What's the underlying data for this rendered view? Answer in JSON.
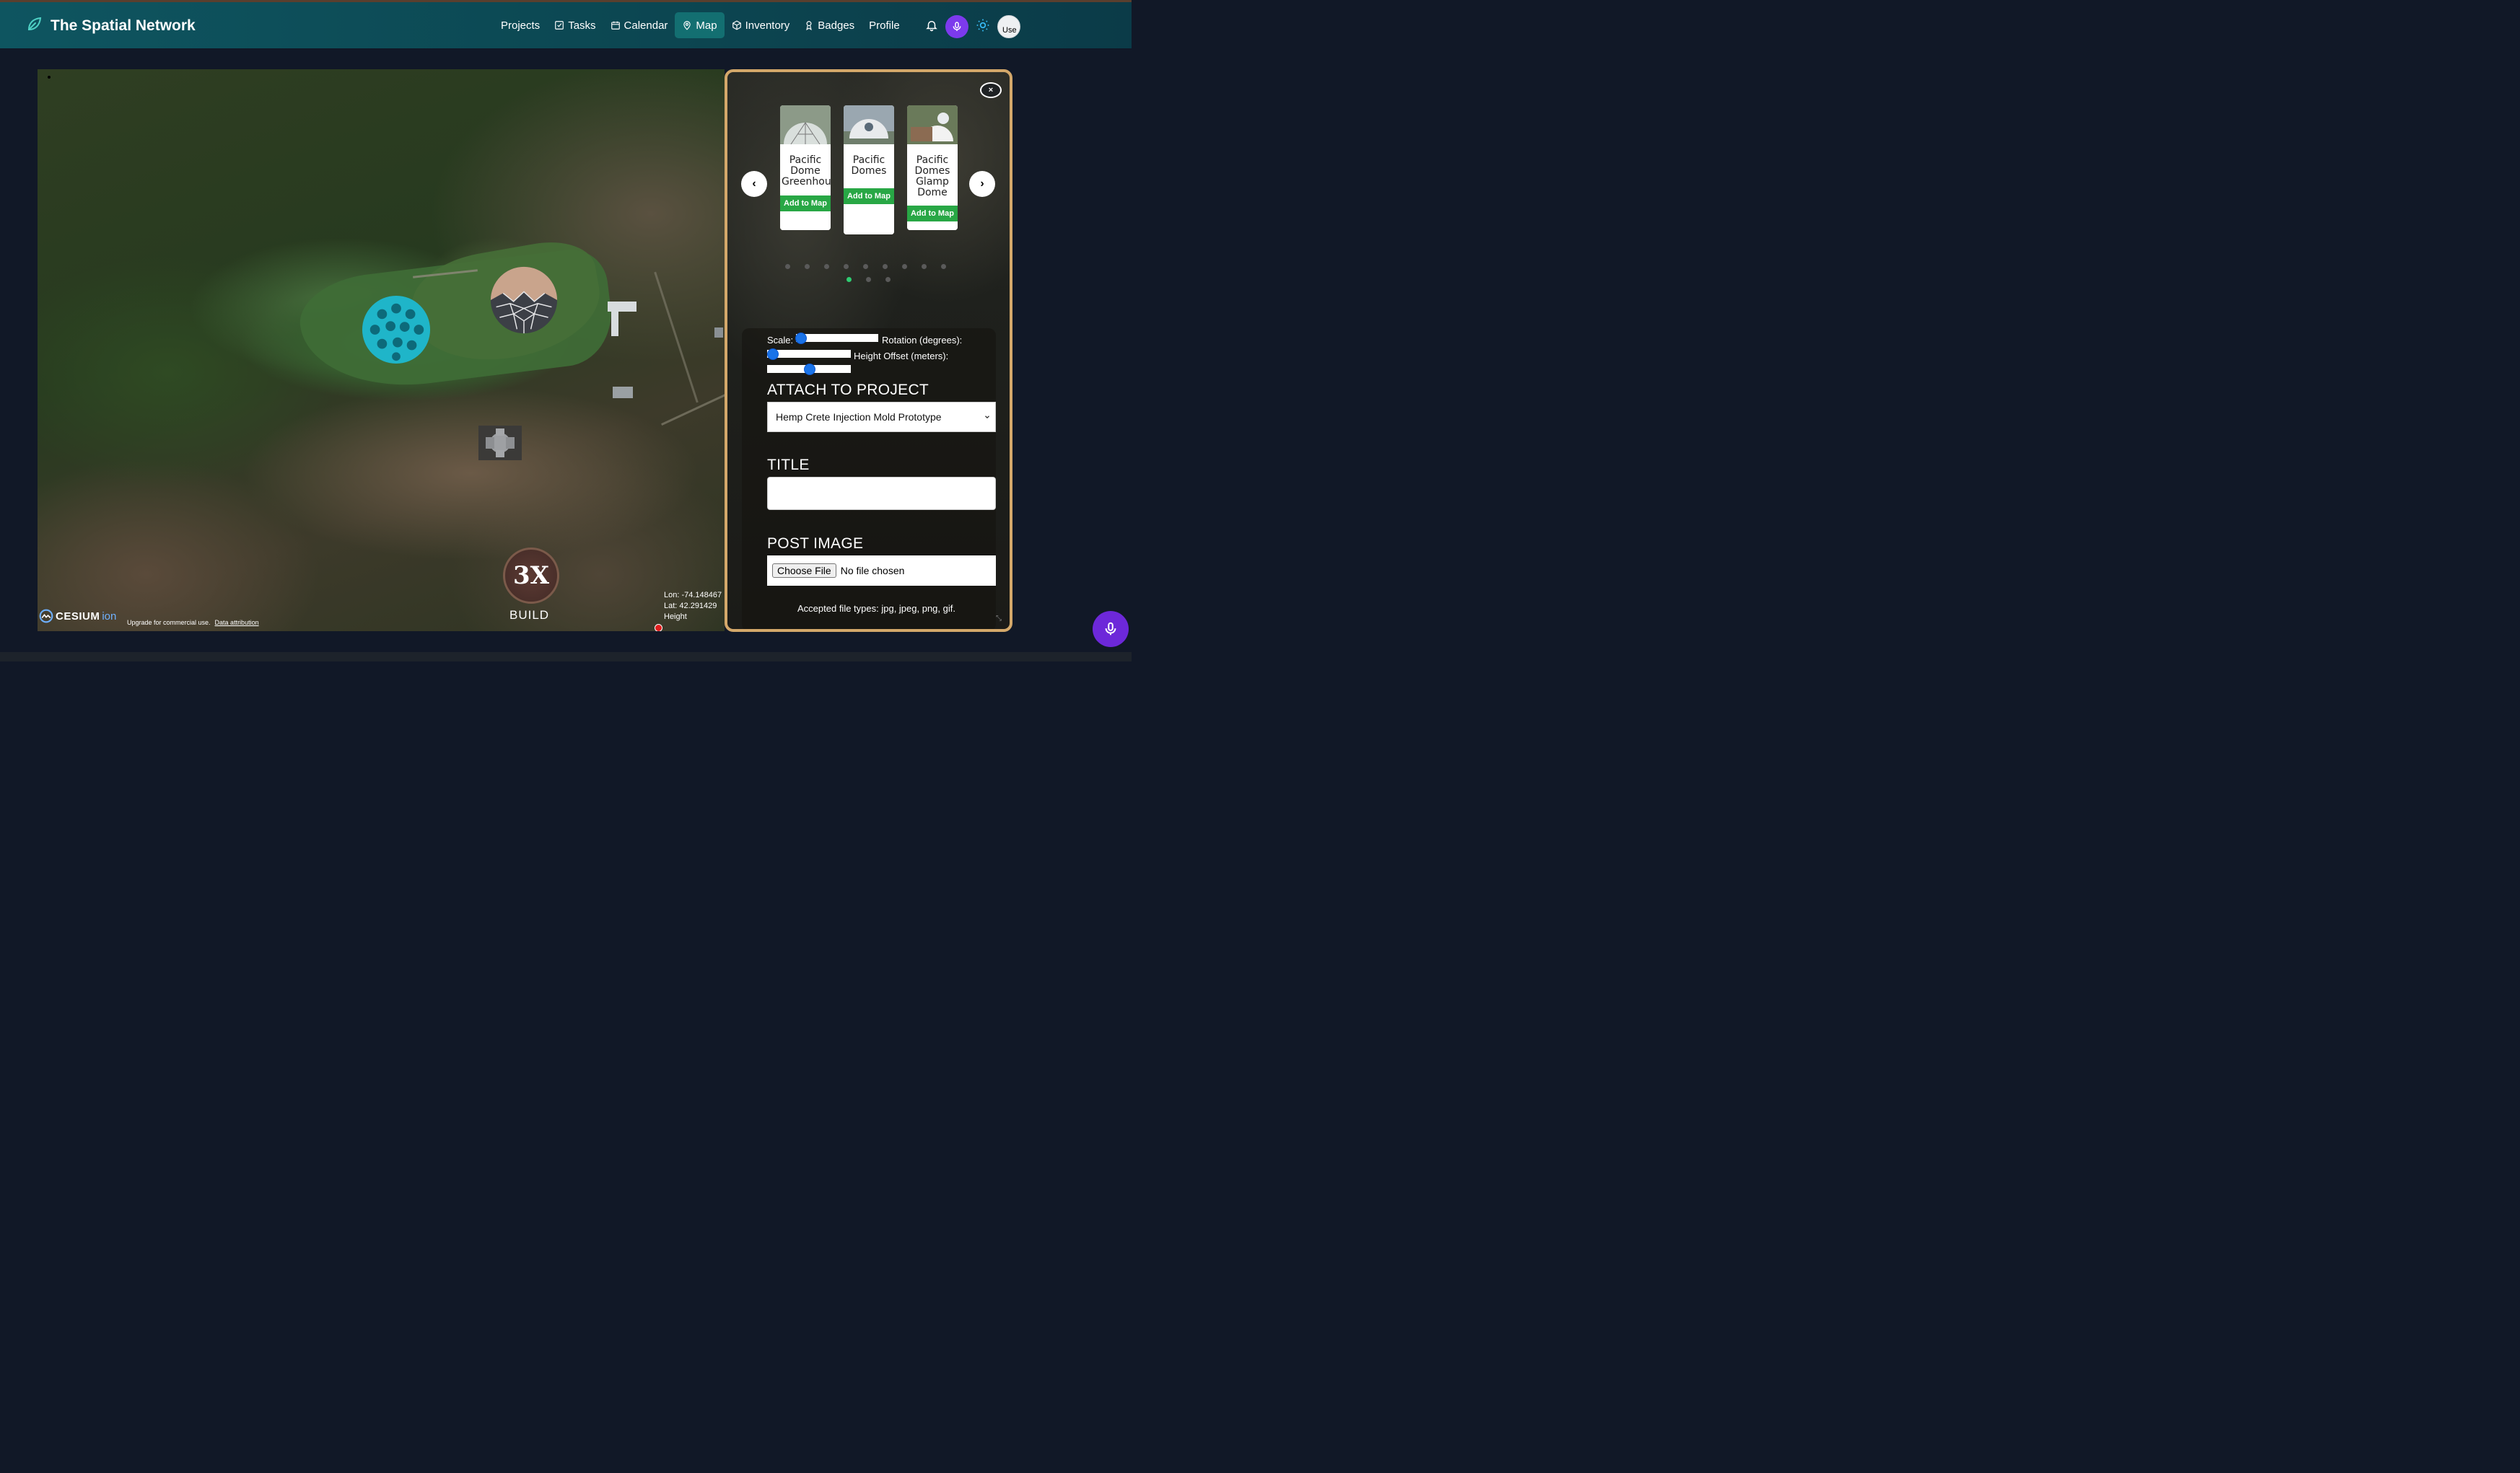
{
  "brand": {
    "title": "The Spatial Network"
  },
  "nav": {
    "items": [
      {
        "label": "Projects",
        "icon": ""
      },
      {
        "label": "Tasks",
        "icon": "check-square-icon"
      },
      {
        "label": "Calendar",
        "icon": "calendar-icon"
      },
      {
        "label": "Map",
        "icon": "map-pin-icon",
        "active": true
      },
      {
        "label": "Inventory",
        "icon": "box-icon"
      },
      {
        "label": "Badges",
        "icon": "award-icon"
      },
      {
        "label": "Profile",
        "icon": ""
      }
    ],
    "avatar_alt": "Use"
  },
  "map": {
    "build_icon_text": "3X",
    "build_label": "BUILD",
    "cesium_brand": "CESIUM",
    "cesium_ion": "ion",
    "upgrade_text": "Upgrade for commercial use.",
    "attribution_link": "Data attribution",
    "lon": "Lon: -74.148467",
    "lat": "Lat: 42.291429",
    "height": "Height"
  },
  "panel": {
    "close_label": "×",
    "prev_label": "‹",
    "next_label": "›",
    "cards": [
      {
        "title": "Pacific Dome Greenhouse",
        "button": "Add to Map"
      },
      {
        "title": "Pacific Domes",
        "button": "Add to Map"
      },
      {
        "title": "Pacific Domes Glamp Dome",
        "button": "Add to Map"
      }
    ],
    "scale_label": "Scale:",
    "rotation_label": "Rotation (degrees):",
    "height_label": "Height Offset (meters):",
    "attach_heading": "ATTACH TO PROJECT",
    "project_selected": "Hemp Crete Injection Mold Prototype",
    "title_heading": "TITLE",
    "title_value": "",
    "post_image_heading": "POST IMAGE",
    "choose_file": "Choose File",
    "no_file": "No file chosen",
    "accepted": "Accepted file types: jpg, jpeg, png, gif."
  },
  "colors": {
    "nav_bg": "#0c4752",
    "panel_border": "#d4a86a",
    "add_button": "#28a745",
    "mic": "#7c3aed"
  }
}
